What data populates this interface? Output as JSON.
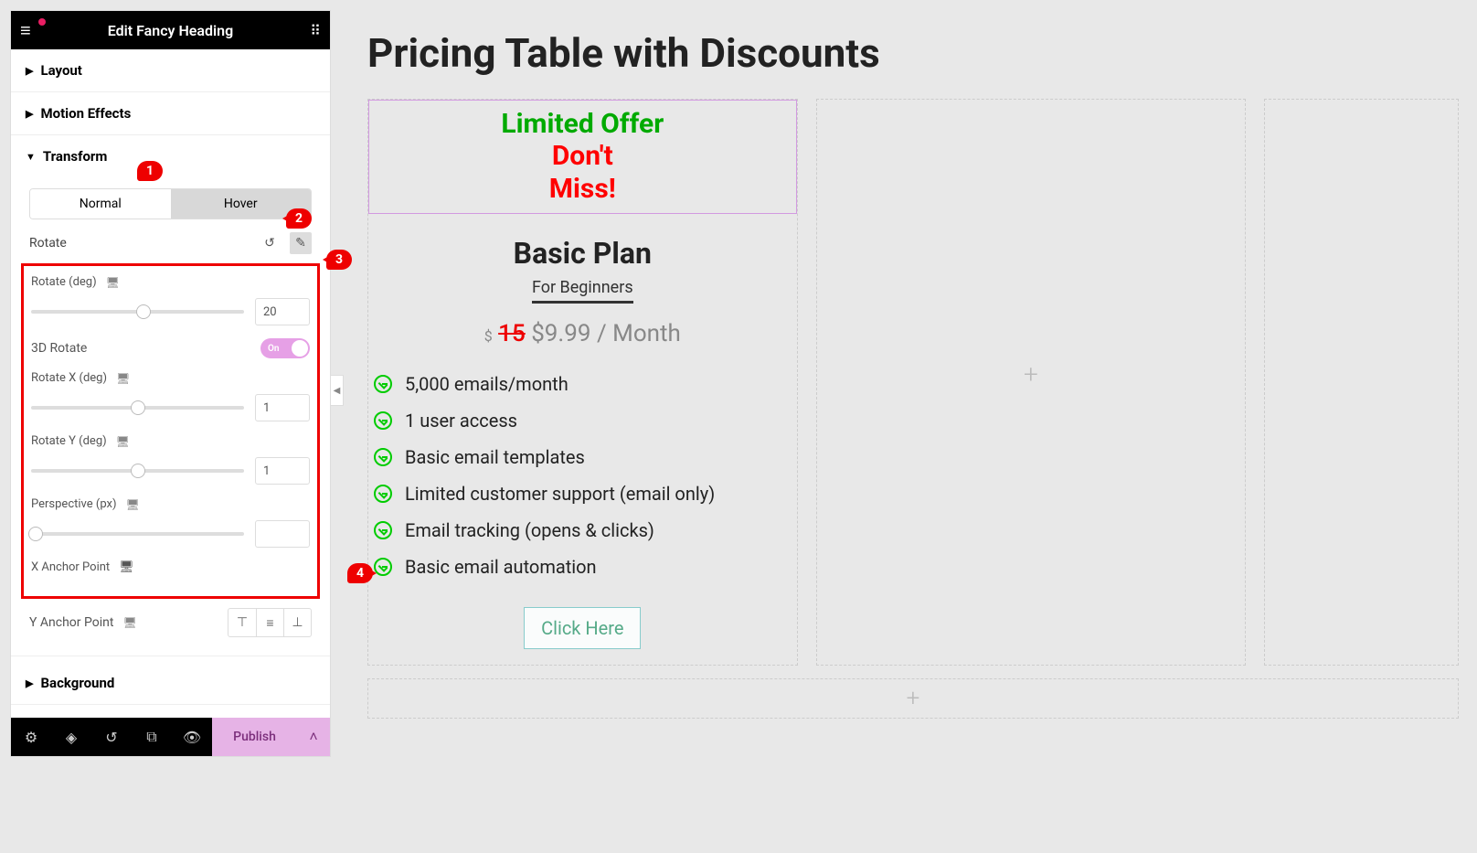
{
  "sidebar": {
    "title": "Edit Fancy Heading",
    "sections": {
      "layout": "Layout",
      "motion": "Motion Effects",
      "transform": "Transform",
      "background": "Background"
    },
    "state_tabs": {
      "normal": "Normal",
      "hover": "Hover"
    },
    "rotate": {
      "label": "Rotate",
      "rotate_deg": {
        "label": "Rotate (deg)",
        "value": "20"
      },
      "rotate_3d": {
        "label": "3D Rotate",
        "state": "On"
      },
      "rotate_x": {
        "label": "Rotate X (deg)",
        "value": "1"
      },
      "rotate_y": {
        "label": "Rotate Y (deg)",
        "value": "1"
      },
      "perspective": {
        "label": "Perspective (px)",
        "value": ""
      },
      "x_anchor": "X Anchor Point",
      "y_anchor": "Y Anchor Point"
    },
    "footer": {
      "publish": "Publish"
    }
  },
  "canvas": {
    "page_title": "Pricing Table with Discounts",
    "offer": {
      "line1": "Limited Offer",
      "line2": "Don't",
      "line3": "Miss!"
    },
    "plan_name": "Basic Plan",
    "plan_sub": "For Beginners",
    "price": {
      "currency": "$",
      "old": "15",
      "new": "$9.99 / Month"
    },
    "features": [
      "5,000 emails/month",
      "1 user access",
      "Basic email templates",
      "Limited customer support (email only)",
      "Email tracking (opens & clicks)",
      "Basic email automation"
    ],
    "cta": "Click Here"
  },
  "badges": {
    "b1": "1",
    "b2": "2",
    "b3": "3",
    "b4": "4"
  }
}
